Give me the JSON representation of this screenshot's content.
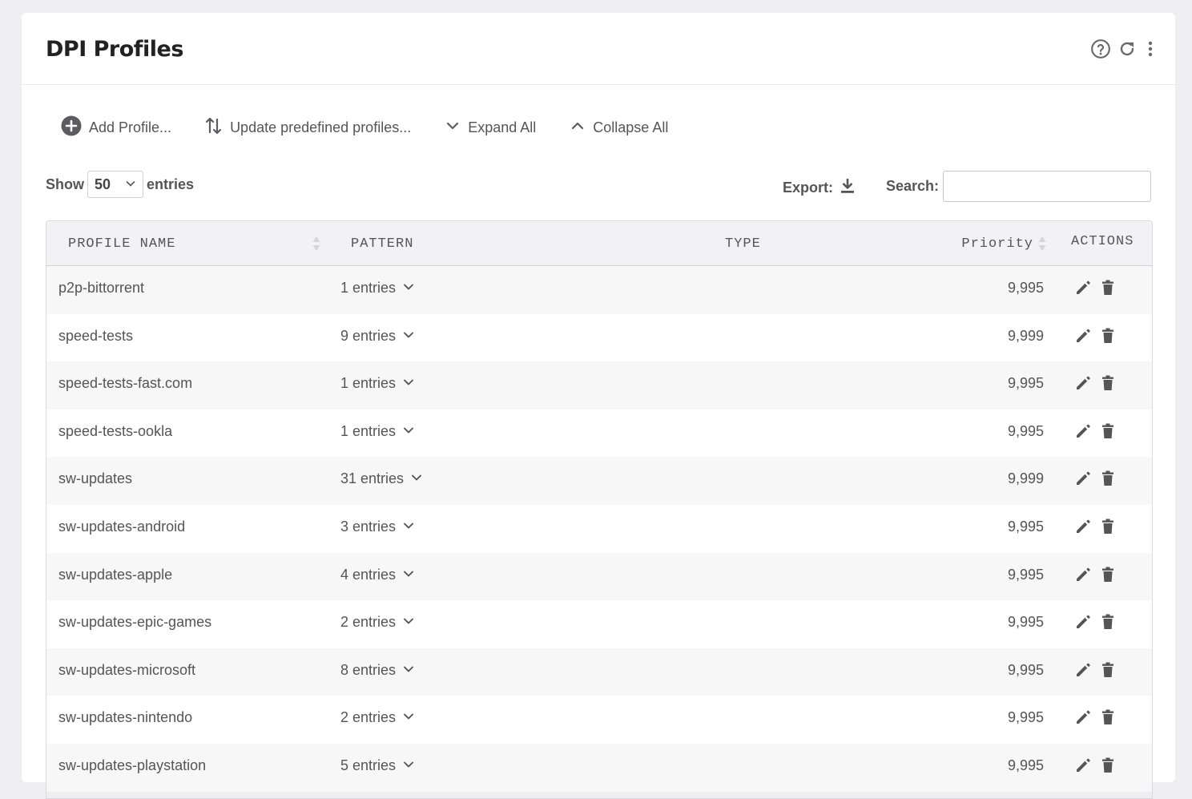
{
  "page": {
    "title": "DPI Profiles"
  },
  "header_icons": [
    "help-icon",
    "refresh-icon",
    "more-vert-icon"
  ],
  "toolbar": {
    "add_profile": "Add Profile...",
    "update_predefined": "Update predefined profiles...",
    "expand_all": "Expand All",
    "collapse_all": "Collapse All"
  },
  "length": {
    "show": "Show",
    "value": "50",
    "entries": "entries"
  },
  "export": {
    "label": "Export:"
  },
  "search": {
    "label": "Search:",
    "value": ""
  },
  "table": {
    "columns": {
      "name": "PROFILE NAME",
      "pattern": "PATTERN",
      "type": "TYPE",
      "priority": "Priority",
      "actions": "ACTIONS"
    },
    "rows": [
      {
        "name": "p2p-bittorrent",
        "pattern": "1 entries",
        "type": "",
        "priority": "9,995"
      },
      {
        "name": "speed-tests",
        "pattern": "9 entries",
        "type": "",
        "priority": "9,999"
      },
      {
        "name": "speed-tests-fast.com",
        "pattern": "1 entries",
        "type": "",
        "priority": "9,995"
      },
      {
        "name": "speed-tests-ookla",
        "pattern": "1 entries",
        "type": "",
        "priority": "9,995"
      },
      {
        "name": "sw-updates",
        "pattern": "31 entries",
        "type": "",
        "priority": "9,999"
      },
      {
        "name": "sw-updates-android",
        "pattern": "3 entries",
        "type": "",
        "priority": "9,995"
      },
      {
        "name": "sw-updates-apple",
        "pattern": "4 entries",
        "type": "",
        "priority": "9,995"
      },
      {
        "name": "sw-updates-epic-games",
        "pattern": "2 entries",
        "type": "",
        "priority": "9,995"
      },
      {
        "name": "sw-updates-microsoft",
        "pattern": "8 entries",
        "type": "",
        "priority": "9,995"
      },
      {
        "name": "sw-updates-nintendo",
        "pattern": "2 entries",
        "type": "",
        "priority": "9,995"
      },
      {
        "name": "sw-updates-playstation",
        "pattern": "5 entries",
        "type": "",
        "priority": "9,995"
      }
    ]
  },
  "colors": {
    "background": "#efeef0",
    "card": "#ffffff",
    "header_row": "#f2f1f3",
    "stripe": "#f7f7f8",
    "icon": "#555555"
  }
}
